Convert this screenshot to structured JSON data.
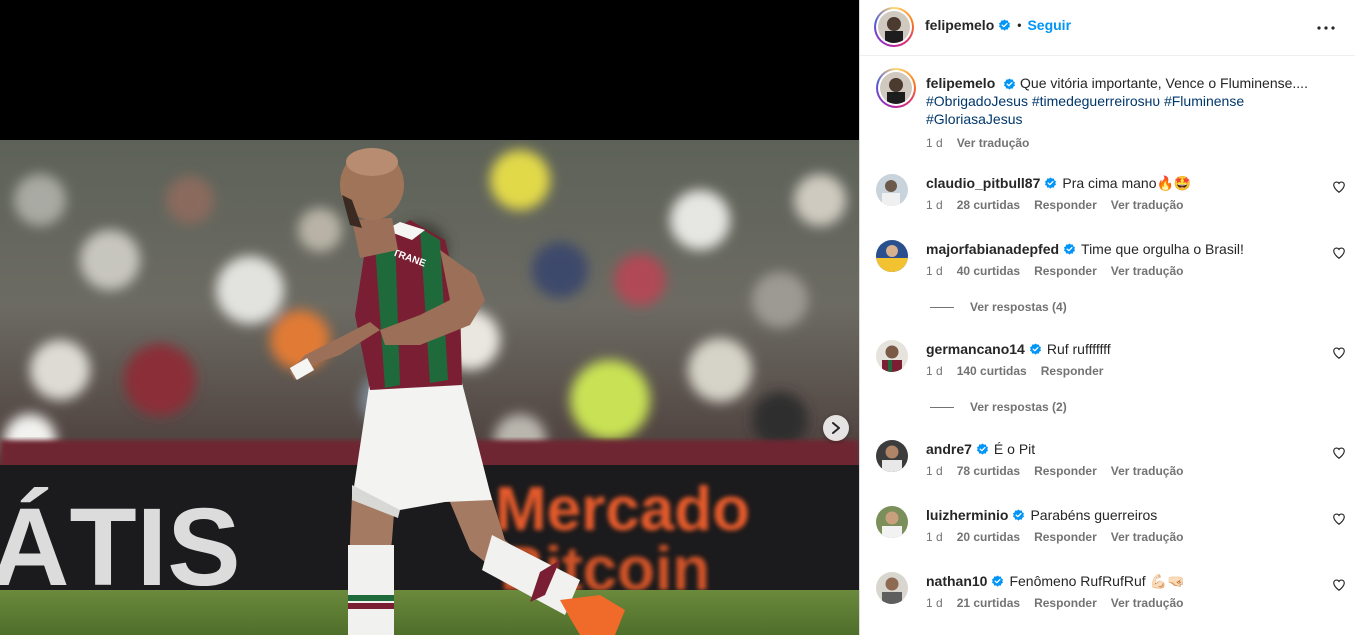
{
  "post": {
    "username": "felipemelo",
    "follow_label": "Seguir",
    "separator": "•",
    "caption": {
      "text": "Que vitória importante, Vence o Fluminense....",
      "hashtags": [
        "#ObrigadoJesus",
        "#timedeguerreirosʜᴜ",
        "#Fluminense",
        "#GloriasaJesus"
      ],
      "time": "1 d",
      "translate": "Ver tradução"
    },
    "photo_overlay": {
      "jersey_text": "TRANE",
      "board_text_left": "ÁTIS",
      "board_text_right_1": "Mercado",
      "board_text_right_2": "Bitcoin"
    }
  },
  "comments": [
    {
      "user": "claudio_pitbull87",
      "text": "Pra cima mano🔥🤩",
      "time": "1 d",
      "likes": "28 curtidas",
      "reply": "Responder",
      "translate": "Ver tradução",
      "avatar_color": "#c9d3dc"
    },
    {
      "user": "majorfabianadepfed",
      "text": "Time que orgulha o Brasil!",
      "time": "1 d",
      "likes": "40 curtidas",
      "reply": "Responder",
      "translate": "Ver tradução",
      "avatar_color": "#2a4f8f",
      "view_replies": "Ver respostas (4)"
    },
    {
      "user": "germancano14",
      "text": "Ruf rufffffff",
      "time": "1 d",
      "likes": "140 curtidas",
      "reply": "Responder",
      "translate": "",
      "avatar_color": "#8a7c6e",
      "view_replies": "Ver respostas (2)"
    },
    {
      "user": "andre7",
      "text": "É o Pit",
      "time": "1 d",
      "likes": "78 curtidas",
      "reply": "Responder",
      "translate": "Ver tradução",
      "avatar_color": "#3c3c3c"
    },
    {
      "user": "luizherminio",
      "text": "Parabéns guerreiros",
      "time": "1 d",
      "likes": "20 curtidas",
      "reply": "Responder",
      "translate": "Ver tradução",
      "avatar_color": "#7b8f5a"
    },
    {
      "user": "nathan10",
      "text": "Fenômeno RufRufRuf 💪🏻🤜🏻",
      "time": "1 d",
      "likes": "21 curtidas",
      "reply": "Responder",
      "translate": "Ver tradução",
      "avatar_color": "#5e5e5e"
    }
  ],
  "colors": {
    "link_blue": "#0095f6",
    "hashtag_blue": "#00376b",
    "verified_blue": "#0095f6",
    "muted_text": "#737373",
    "jersey_maroon": "#7a1f33",
    "jersey_green": "#1e6a3a"
  },
  "icons": {
    "verified": "verified-badge-icon",
    "more": "more-options-icon",
    "heart": "heart-outline-icon",
    "next": "chevron-right-icon"
  }
}
